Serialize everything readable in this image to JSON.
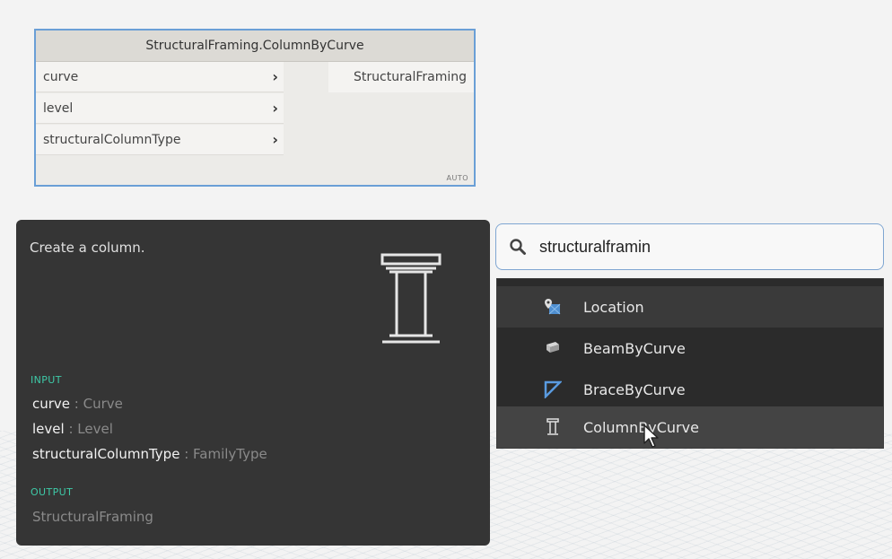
{
  "node": {
    "title": "StructuralFraming.ColumnByCurve",
    "inputs": [
      "curve",
      "level",
      "structuralColumnType"
    ],
    "output": "StructuralFraming",
    "lacing": "AUTO"
  },
  "tooltip": {
    "description": "Create a column.",
    "input_header": "INPUT",
    "params": [
      {
        "name": "curve",
        "type": " : Curve"
      },
      {
        "name": "level",
        "type": " : Level"
      },
      {
        "name": "structuralColumnType",
        "type": " : FamilyType"
      }
    ],
    "output_header": "OUTPUT",
    "output": "StructuralFraming",
    "icon": "column-icon"
  },
  "search": {
    "value": "structuralframin",
    "icon": "search-icon"
  },
  "results": [
    {
      "label": "Location",
      "icon": "location-icon"
    },
    {
      "label": "BeamByCurve",
      "icon": "beam-icon"
    },
    {
      "label": "BraceByCurve",
      "icon": "brace-icon"
    },
    {
      "label": "ColumnByCurve",
      "icon": "column-icon"
    }
  ],
  "colors": {
    "node_border": "#6a9fd6",
    "tooltip_bg": "#353535",
    "section_header": "#3ec9a7",
    "results_bg": "#2b2b2b",
    "result_highlight": "#444444",
    "search_border": "#7fa6d2"
  }
}
